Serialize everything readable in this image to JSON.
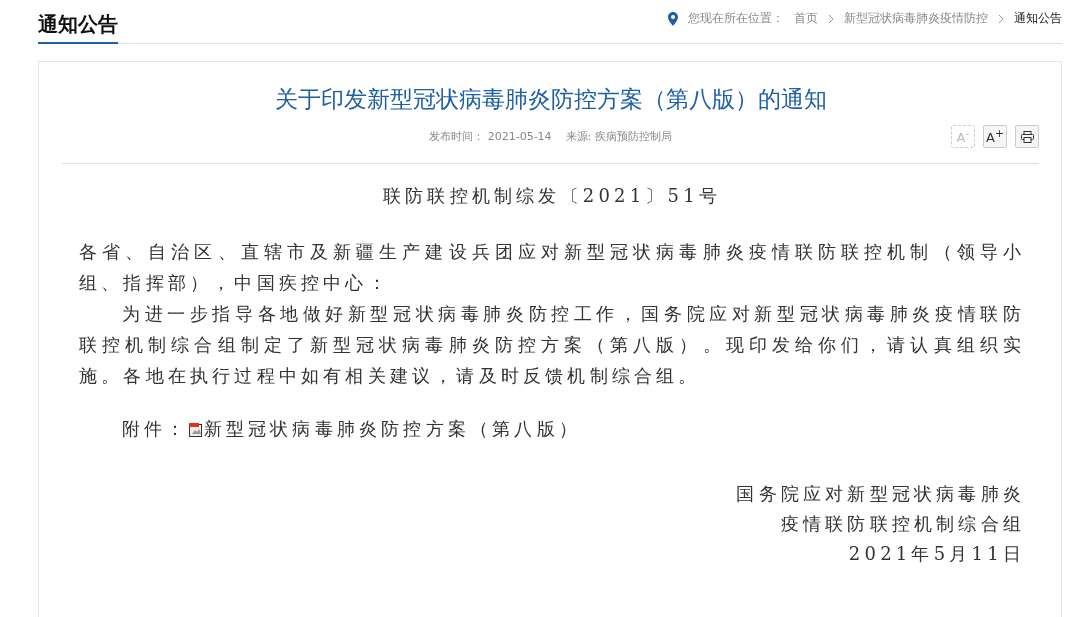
{
  "section_title": "通知公告",
  "breadcrumb": {
    "label": "您现在所在位置：",
    "items": [
      {
        "text": "首页",
        "current": false
      },
      {
        "text": "新型冠状病毒肺炎疫情防控",
        "current": false
      },
      {
        "text": "通知公告",
        "current": true
      }
    ]
  },
  "article": {
    "title": "关于印发新型冠状病毒肺炎防控方案（第八版）的通知",
    "meta": [
      {
        "label": "发布时间：",
        "value": "2021-05-14"
      },
      {
        "label": "来源:",
        "value": "疾病预防控制局"
      }
    ],
    "tools": [
      {
        "kind": "font",
        "label": "A$^{-}$",
        "disabled": true
      },
      {
        "kind": "font",
        "label": "A$^{+}$",
        "disabled": false
      },
      {
        "kind": "print",
        "disabled": false
      }
    ],
    "doc_number": "联防联控机制综发〔2021〕51号",
    "paragraphs": [
      {
        "text": "各省、自治区、直辖市及新疆生产建设兵团应对新型冠状病毒肺炎疫情联防联控机制（领导小组、指挥部），中国疾控中心：",
        "indent": false
      },
      {
        "text": "为进一步指导各地做好新型冠状病毒肺炎防控工作，国务院应对新型冠状病毒肺炎疫情联防联控机制综合组制定了新型冠状病毒肺炎防控方案（第八版）。现印发给你们，请认真组织实施。各地在执行过程中如有相关建议，请及时反馈机制综合组。",
        "indent": true
      }
    ],
    "attachment": {
      "label": "附件：",
      "file": "新型冠状病毒肺炎防控方案（第八版）"
    },
    "signature": [
      "国务院应对新型冠状病毒肺炎",
      "疫情联防联控机制综合组",
      "2021年5月11日"
    ]
  }
}
